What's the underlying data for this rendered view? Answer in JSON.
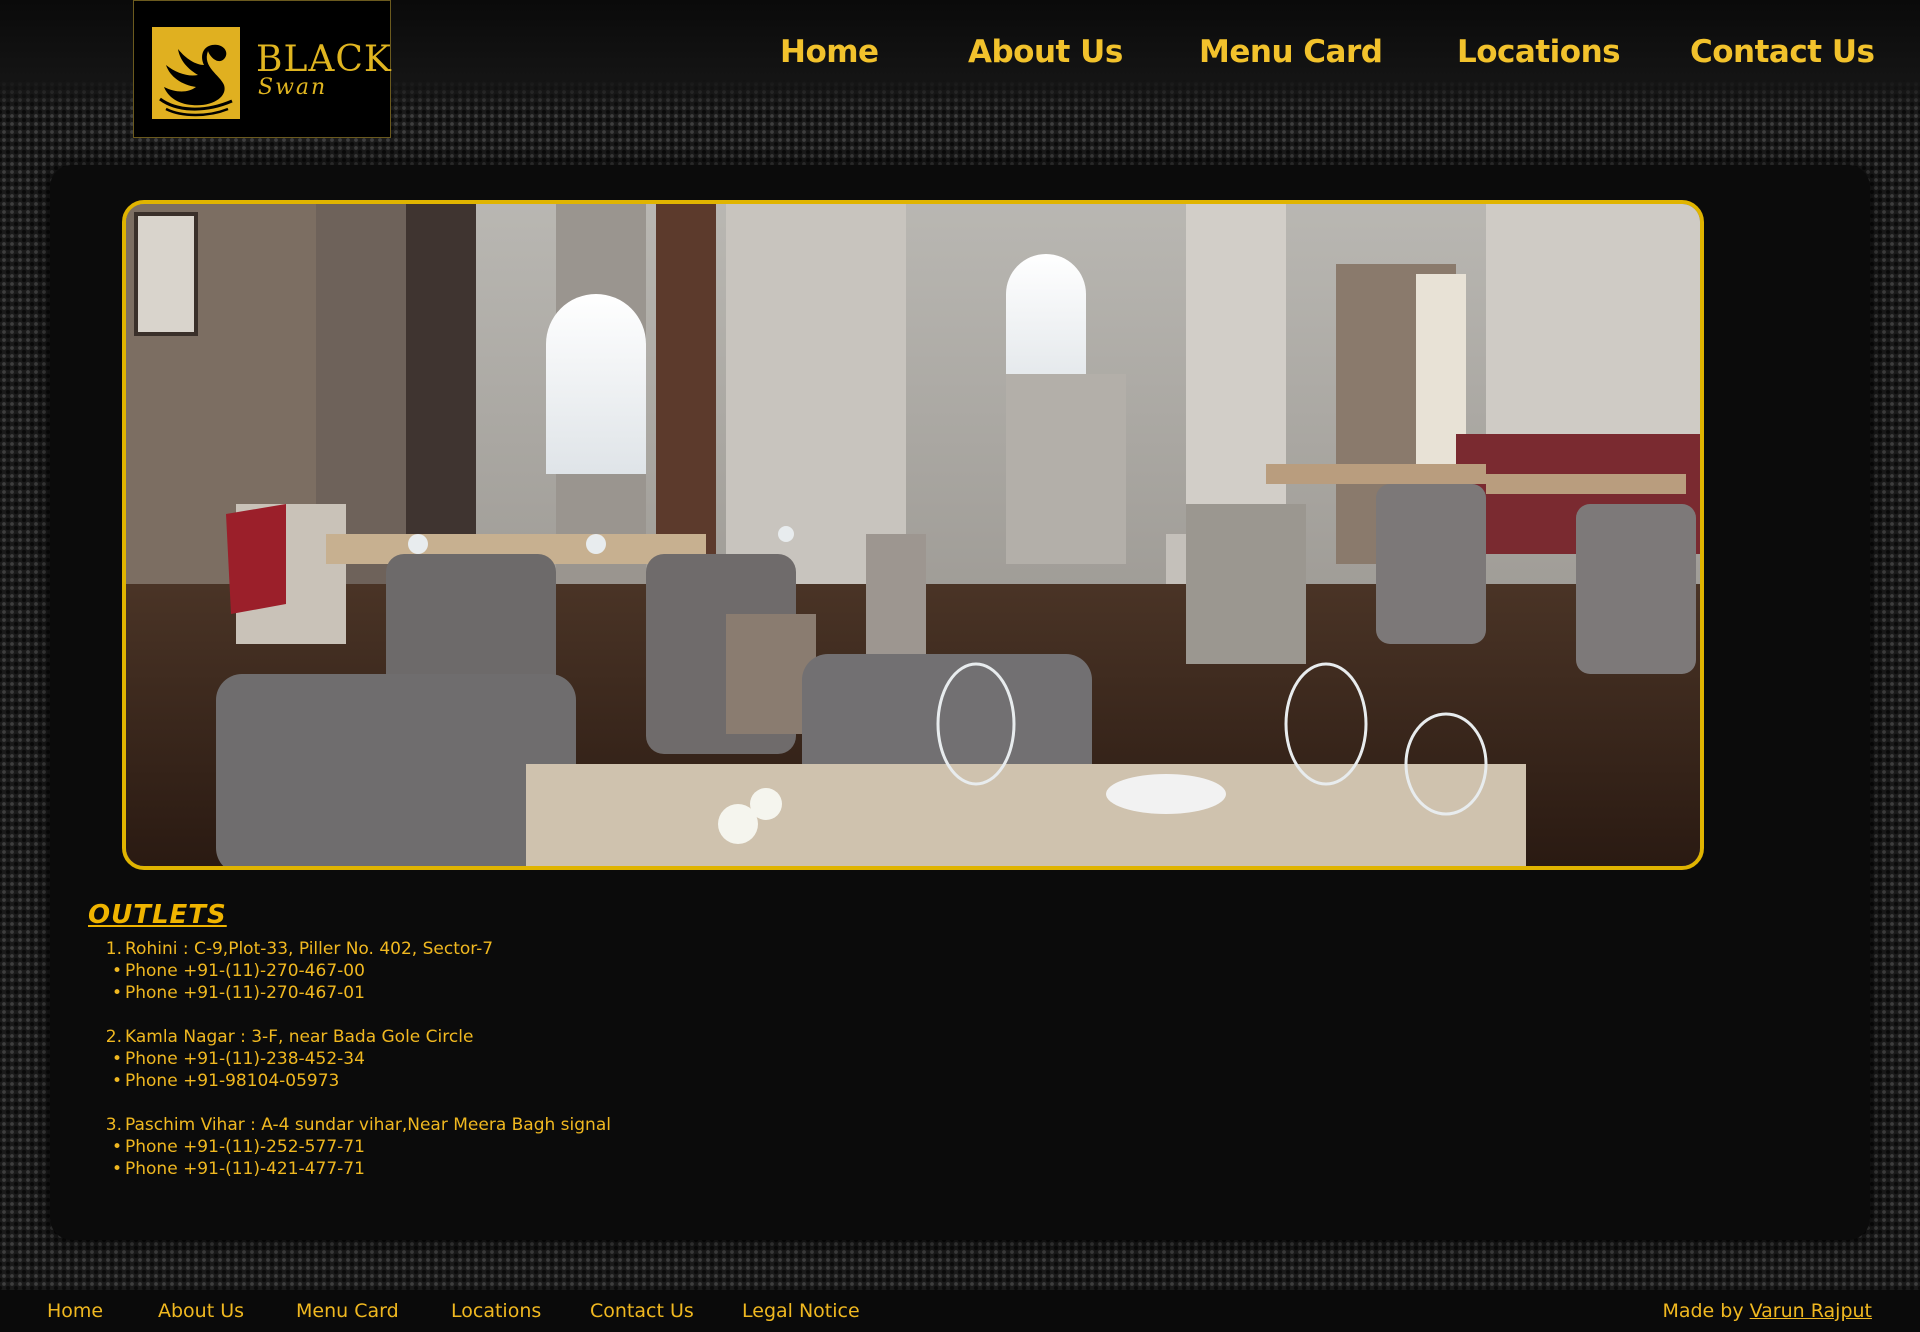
{
  "brand": {
    "name": "BLACK",
    "script": "Swan",
    "accent": "#f2c22c",
    "logo_icon": "swan-icon"
  },
  "nav": [
    {
      "label": "Home"
    },
    {
      "label": "About Us"
    },
    {
      "label": "Menu Card"
    },
    {
      "label": "Locations"
    },
    {
      "label": "Contact Us"
    }
  ],
  "hero": {
    "image": "restaurant-interior-photo",
    "border_color": "#e0b400"
  },
  "outlets": {
    "title": "OUTLETS",
    "items": [
      {
        "marker": "1.",
        "text": "Rohini : C-9,Plot-33, Piller No. 402, Sector-7",
        "phones": [
          "Phone +91-(11)-270-467-00",
          "Phone +91-(11)-270-467-01"
        ]
      },
      {
        "marker": "2.",
        "text": "Kamla Nagar : 3-F, near Bada Gole Circle",
        "phones": [
          "Phone +91-(11)-238-452-34",
          "Phone +91-98104-05973"
        ]
      },
      {
        "marker": "3.",
        "text": "Paschim Vihar : A-4 sundar vihar,Near Meera Bagh signal",
        "phones": [
          "Phone +91-(11)-252-577-71",
          "Phone +91-(11)-421-477-71"
        ]
      }
    ]
  },
  "footer": {
    "links": [
      "Home",
      "About Us",
      "Menu Card",
      "Locations",
      "Contact Us",
      "Legal Notice"
    ],
    "credit_prefix": "Made by",
    "credit_name": "Varun Rajput"
  }
}
